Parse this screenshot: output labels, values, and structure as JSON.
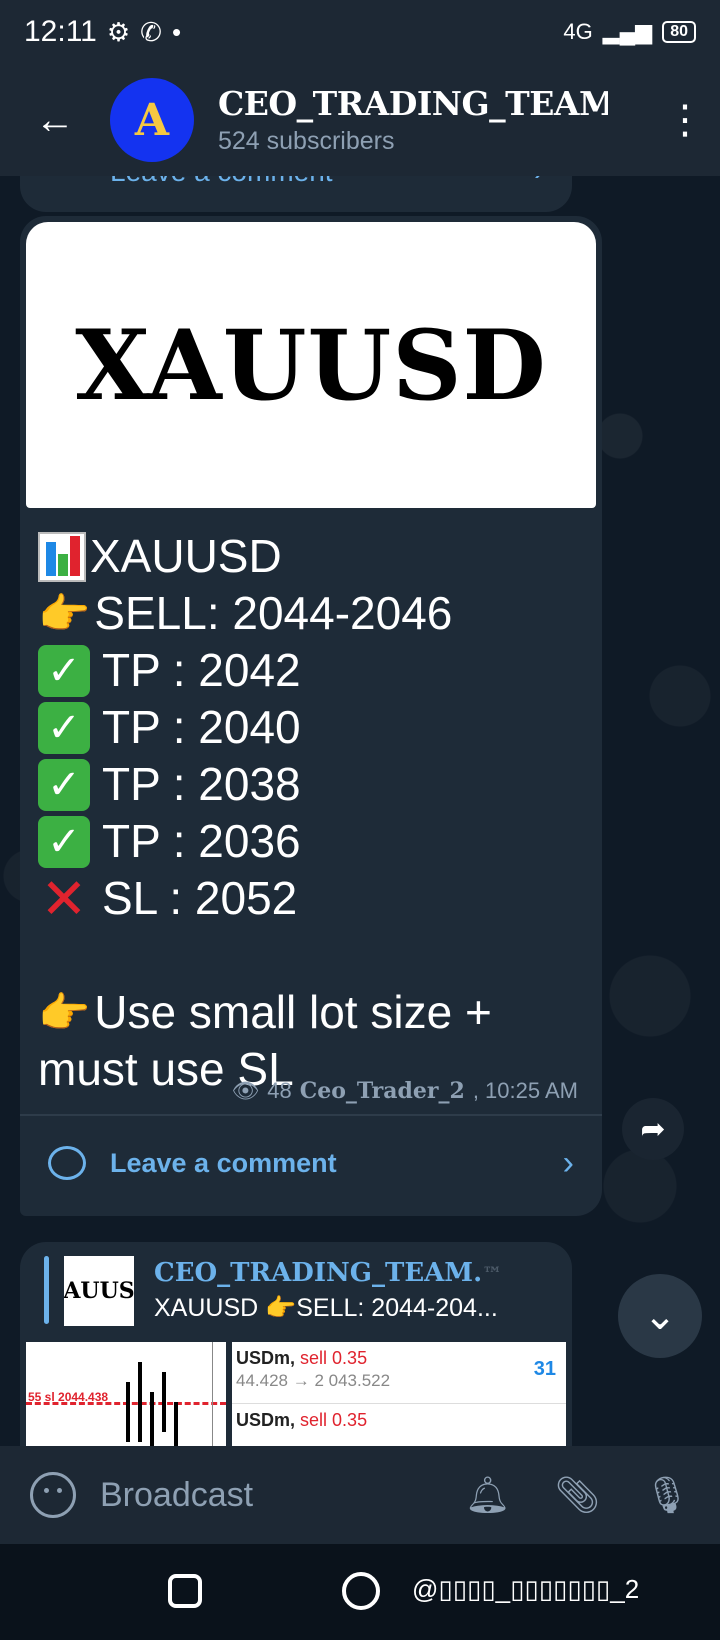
{
  "status_bar": {
    "time": "12:11",
    "network": "4G",
    "battery": "80"
  },
  "header": {
    "back_icon": "arrow-left-icon",
    "channel_title": "CEO_TRADING_TEAM.",
    "subscribers": "524 subscribers",
    "avatar_glyph": "A",
    "menu_icon": "kebab-menu-icon"
  },
  "previous_post": {
    "comment_label": "Leave a comment"
  },
  "post": {
    "banner_text": "XAUUSD",
    "lines": [
      {
        "emoji": "chart",
        "text": "XAUUSD"
      },
      {
        "emoji": "point",
        "text": "SELL: 2044-2046"
      },
      {
        "emoji": "check",
        "text": "TP : 2042"
      },
      {
        "emoji": "check",
        "text": "TP : 2040"
      },
      {
        "emoji": "check",
        "text": "TP : 2038"
      },
      {
        "emoji": "check",
        "text": "TP : 2036"
      },
      {
        "emoji": "cross",
        "text": "SL : 2052"
      }
    ],
    "note_line1": "Use small lot size +",
    "note_line2": "must use SL",
    "views": "48",
    "author": "Ceo_Trader_2",
    "time": ", 10:25 AM",
    "comment_label": "Leave a comment"
  },
  "next_post": {
    "reply_thumb_text": "AUUS",
    "reply_title": "CEO_TRADING_TEAM.",
    "reply_title_suffix": "™",
    "reply_text": "XAUUSD 👉SELL: 2044-204...",
    "chart_label": "55 sl 2044.438",
    "trades": [
      {
        "symbol": "USDm,",
        "action": "sell 0.35",
        "price": "44.428 → 2 043.522",
        "num": "31"
      },
      {
        "symbol": "USDm,",
        "action": "sell 0.35",
        "price": "",
        "num": ""
      }
    ]
  },
  "input": {
    "placeholder": "Broadcast"
  },
  "nav": {
    "watermark": "@▯▯▯▯_▯▯▯▯▯▯▯_2"
  }
}
